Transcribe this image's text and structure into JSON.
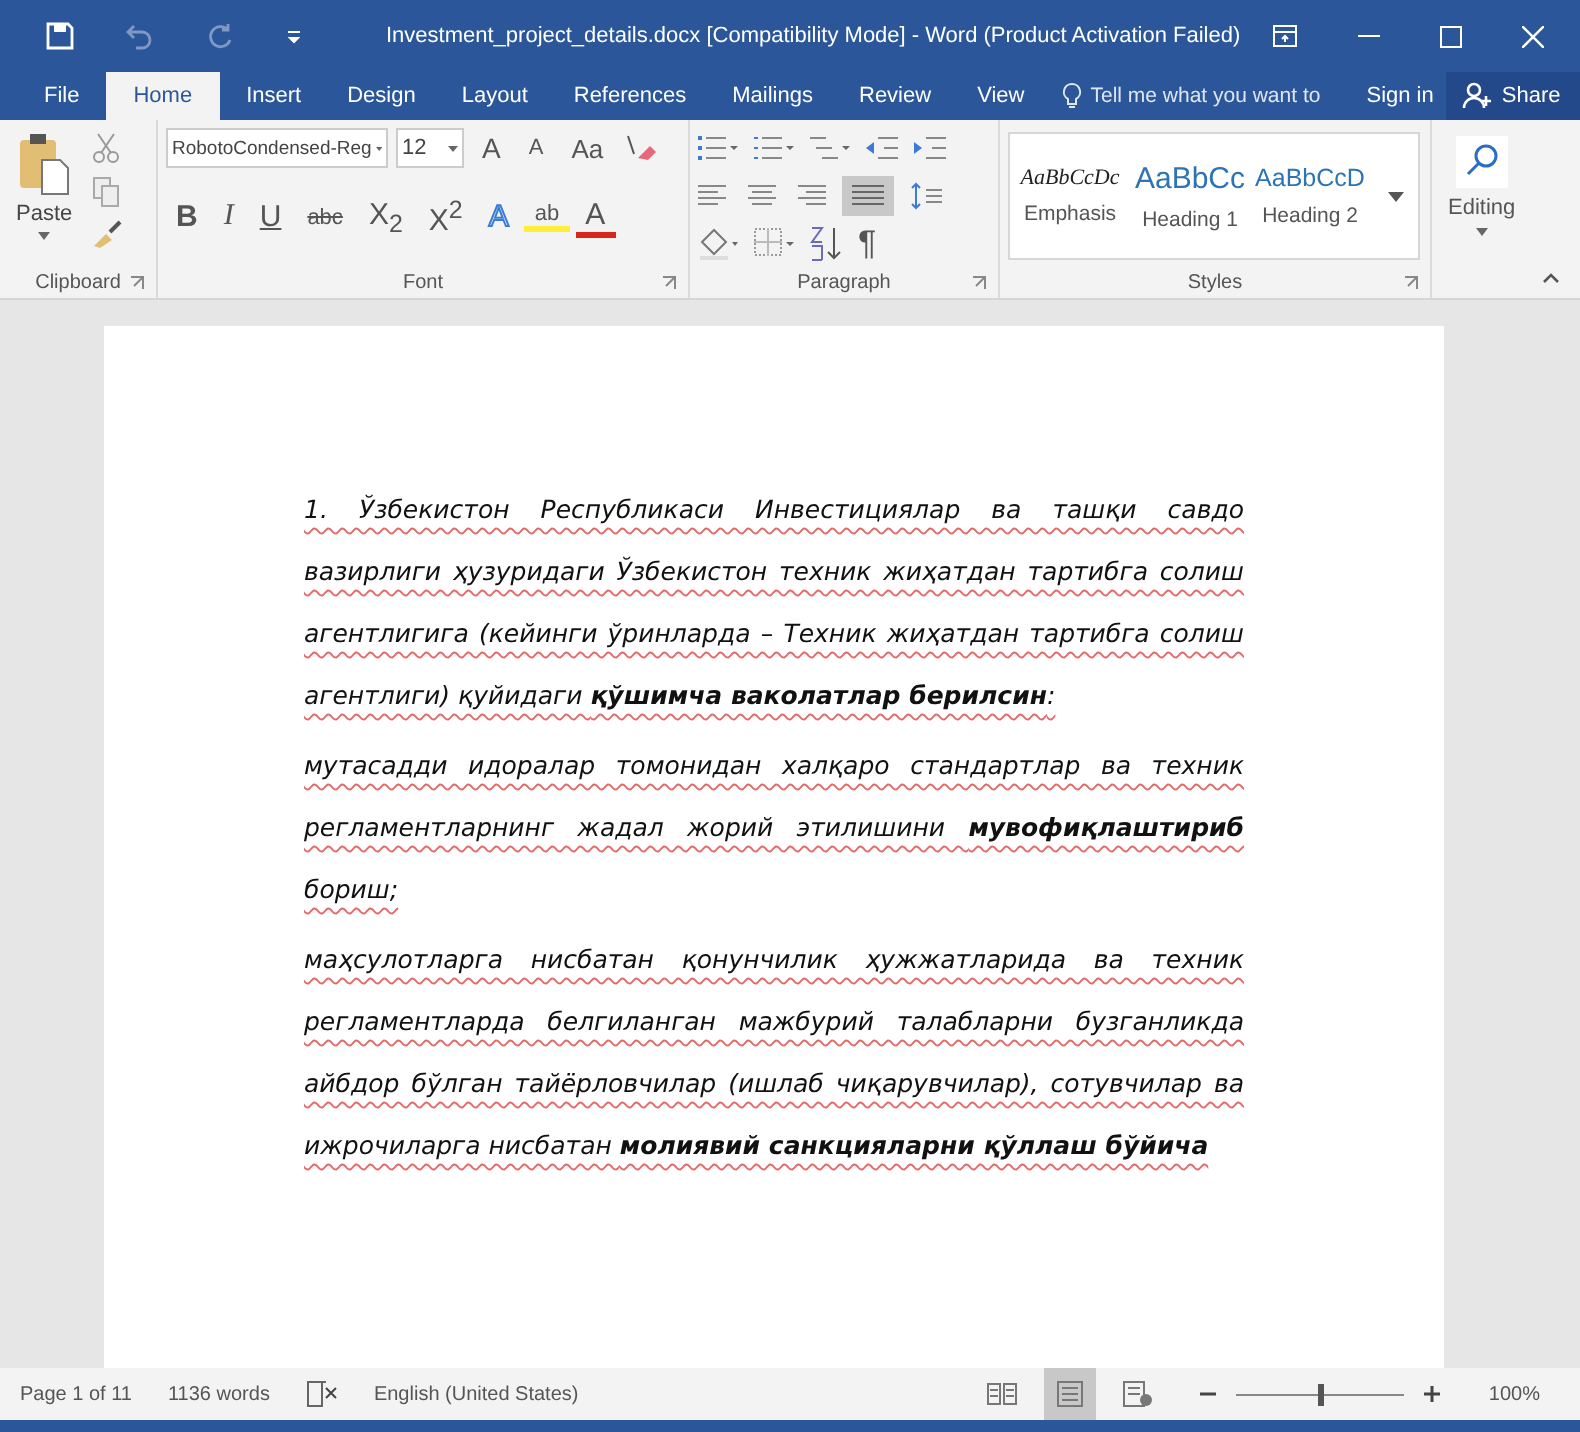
{
  "window": {
    "title": "Investment_project_details.docx [Compatibility Mode] - Word (Product Activation Failed)"
  },
  "tabs": [
    {
      "label": "File",
      "selected": false
    },
    {
      "label": "Home",
      "selected": true
    },
    {
      "label": "Insert",
      "selected": false
    },
    {
      "label": "Design",
      "selected": false
    },
    {
      "label": "Layout",
      "selected": false
    },
    {
      "label": "References",
      "selected": false
    },
    {
      "label": "Mailings",
      "selected": false
    },
    {
      "label": "Review",
      "selected": false
    },
    {
      "label": "View",
      "selected": false
    }
  ],
  "tell_me": {
    "placeholder": "Tell me what you want to"
  },
  "sign_in": "Sign in",
  "share": "Share",
  "clipboard": {
    "paste": "Paste",
    "group": "Clipboard"
  },
  "font": {
    "name": "RobotoCondensed-Reg",
    "size": "12",
    "group": "Font",
    "row1": [
      {
        "kind": "grow",
        "label": "A"
      },
      {
        "kind": "shrink",
        "label": "A"
      },
      {
        "kind": "case",
        "label": "Aa"
      }
    ],
    "row2": [
      {
        "kind": "bold",
        "label": "B"
      },
      {
        "kind": "italic",
        "label": "I"
      },
      {
        "kind": "underline",
        "label": "U"
      },
      {
        "kind": "strike",
        "label": "abc"
      },
      {
        "kind": "sub",
        "label": "X$_{2}$"
      },
      {
        "kind": "sup",
        "label": "X$^{2}$"
      },
      {
        "kind": "effects",
        "label": "A"
      },
      {
        "kind": "highlight",
        "label": "ab"
      },
      {
        "kind": "color",
        "label": "A"
      }
    ]
  },
  "paragraph": {
    "group": "Paragraph",
    "pilcrow": "¶"
  },
  "styles": {
    "group": "Styles",
    "items": [
      {
        "kind": "emphasis",
        "sample": "AaBbCcDc",
        "name": "Emphasis"
      },
      {
        "kind": "heading1",
        "sample": "AaBbCc",
        "name": "Heading 1"
      },
      {
        "kind": "heading2",
        "sample": "AaBbCcD",
        "name": "Heading 2"
      }
    ]
  },
  "editing": "Editing",
  "document": {
    "paragraphs": [
      "1. Ўзбекистон Республикаси Инвестициялар ва ташқи савдо вазирлиги ҳузуридаги Ўзбекистон техник жиҳатдан тартибга солиш агентлигига (кейинги ўринларда – Техник жиҳатдан тартибга солиш агентлиги) қуйидаги **қўшимча ваколатлар берилсин**:",
      "мутасадди идоралар томонидан халқаро стандартлар ва техник регламентларнинг жадал жорий этилишини **мувофиқлаштириб** бориш;",
      "маҳсулотларга нисбатан қонунчилик ҳужжатларида ва техник регламентларда белгиланган мажбурий талабларни бузганликда айбдор бўлган тайёрловчилар (ишлаб чиқарувчилар), сотувчилар ва ижрочиларга нисбатан **молиявий санкцияларни қўллаш бўйича**"
    ]
  },
  "status_bar": {
    "page": "Page 1 of 11",
    "words": "1136 words",
    "language": "English (United States)",
    "views": [
      {
        "kind": "read",
        "selected": false
      },
      {
        "kind": "print",
        "selected": true
      },
      {
        "kind": "web",
        "selected": false
      }
    ],
    "zoom": {
      "level": 0.5,
      "reading": "100%"
    }
  }
}
